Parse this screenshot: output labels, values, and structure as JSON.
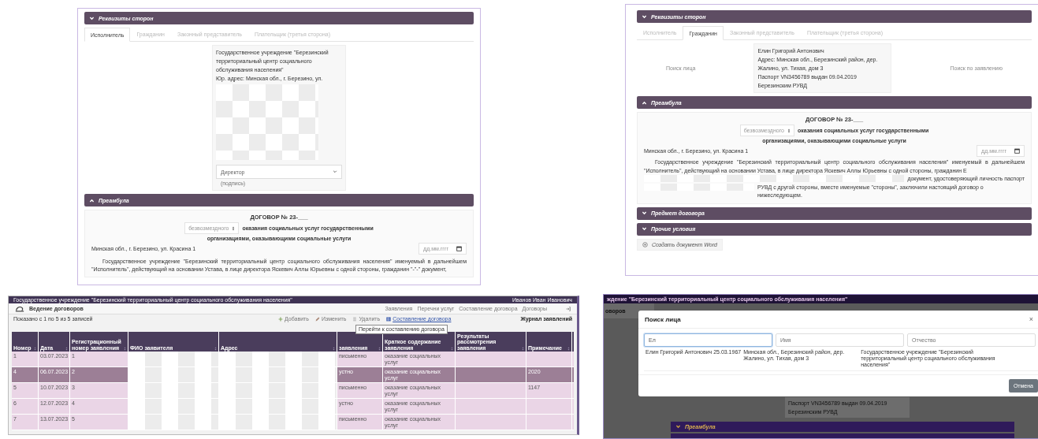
{
  "form_executor": {
    "sections": [
      {
        "title": "Реквизиты сторон",
        "kind": "down"
      },
      {
        "title": "Преамбула",
        "kind": "up"
      }
    ],
    "tabs": [
      {
        "label": "Исполнитель",
        "selected": true
      },
      {
        "label": "Гражданин",
        "selected": false
      },
      {
        "label": "Законный представитель",
        "selected": false
      },
      {
        "label": "Плательщик (третья сторона)",
        "selected": false
      }
    ],
    "org_card": {
      "name": "Государственное учреждение \"Березинский территориальный центр социального обслуживания населения\"",
      "address": "Юр. адрес: Минская обл., г. Березино, ул.",
      "signer_select": "Директор",
      "signer_caption": "(подпись)"
    },
    "preamble": {
      "heading": "ДОГОВОР № 23-___",
      "contract_type": "безвозмездного",
      "title_line_1": "оказания социальных услуг государственными",
      "title_line_2": "организациями, оказывающими социальные услуги",
      "place": "Минская обл., г. Березино, ул. Красина 1",
      "date_placeholder": "дд.мм.гггг",
      "paragraph": "Государственное учреждение \"Березинский территориальный центр социального обслуживания населения\" именуемый в дальнейшем \"Исполнитель\", действующий на основании Устава, в лице директора Яскевич Аллы Юрьевны с одной стороны, гражданин \"-\"-\" документ,"
    }
  },
  "form_citizen": {
    "sections": [
      {
        "title": "Реквизиты сторон",
        "kind": "down"
      },
      {
        "title": "Преамбула",
        "kind": "up"
      },
      {
        "title": "Предмет договора",
        "kind": "down"
      },
      {
        "title": "Прочие условия",
        "kind": "down"
      }
    ],
    "tabs": [
      {
        "label": "Исполнитель",
        "selected": false
      },
      {
        "label": "Гражданин",
        "selected": true
      },
      {
        "label": "Законный представитель",
        "selected": false
      },
      {
        "label": "Плательщик (третья сторона)",
        "selected": false
      }
    ],
    "search_person_link": "Поиск лица",
    "search_by_application_link": "Поиск по заявлению",
    "citizen_card": {
      "name": "Елин Григорий Антонович",
      "address": "Адрес: Минская обл., Березинский район, дер. Жалино, ул. Тихая, дом 3",
      "passport": "Паспорт VN3456789 выдан 09.04.2019 Березинским РУВД"
    },
    "preamble": {
      "heading": "ДОГОВОР № 23-___",
      "contract_type": "безвозмездного",
      "title_line_1": "оказания социальных услуг государственными",
      "title_line_2": "организациями, оказывающими социальные услуги",
      "place": "Минская обл., г. Березино, ул. Красина 1",
      "date_placeholder": "дд.мм.гггг",
      "paragraph_parts": [
        "Государственное учреждение \"Березинский территориальный центр социального обслуживания населения\" именуемый в дальнейшем \"Исполнитель\", действующий на основании Устава, в лице директора Яскевич Аллы Юрьевны с одной стороны, гражданин Е",
        "документ, удостоверяющий личность паспорт",
        "РУВД с другой стороны, вместе именуемые \"стороны\", заключили настоящий договор о нижеследующем."
      ]
    },
    "word_button": "Создать документ Word"
  },
  "applications_journal": {
    "top_bar": {
      "organization": "Государственное учреждение \"Березинский территориальный центр социального обслуживания населения\"",
      "user": "Иванов Иван Иванович"
    },
    "app_title": "Ведение договоров",
    "nav": [
      "Заявления",
      "Перечни услуг",
      "Составление договора",
      "Договоры"
    ],
    "records_info": "Показано с 1 по 5 из 5 записей",
    "actions": [
      {
        "label": "Добавить",
        "kind": "add"
      },
      {
        "label": "Изменить",
        "kind": "edit"
      },
      {
        "label": "Удалить",
        "kind": "delete"
      },
      {
        "label": "Составление договора",
        "kind": "compose"
      }
    ],
    "tooltip": "Перейти к составлению договора",
    "journal_title": "Журнал заявлений",
    "columns": [
      "Номер",
      "Дата",
      "Регистрационный номер заявления",
      "ФИО заявителя",
      "Адрес",
      "заявления",
      "Краткое содержание заявления",
      "Результаты рассмотрения заявления",
      "Примечание"
    ],
    "rows": [
      {
        "number": "1",
        "date": "03.07.2023",
        "reg_number": "1",
        "form": "письменно",
        "summary": "оказание социальных услуг",
        "selected": false
      },
      {
        "number": "4",
        "date": "06.07.2023",
        "reg_number": "2",
        "form": "устно",
        "summary": "оказание социальных услуг",
        "note": "2020",
        "selected": true
      },
      {
        "number": "5",
        "date": "10.07.2023",
        "reg_number": "3",
        "form": "письменно",
        "summary": "оказание социальных услуг",
        "note": "1147",
        "selected": false
      },
      {
        "number": "6",
        "date": "12.07.2023",
        "reg_number": "4",
        "form": "устно",
        "summary": "оказание социальных услуг",
        "selected": false
      },
      {
        "number": "7",
        "date": "13.07.2023",
        "reg_number": "5",
        "form": "письменно",
        "summary": "оказание социальных услуг",
        "selected": false
      }
    ]
  },
  "person_search": {
    "background": {
      "top_bar": "ждение \"Березинский территориальный центр социального обслуживания населения\"",
      "app_title": "оворов",
      "card_lines": [
        "Паспорт VN3456789 выдан 09.04.2019",
        "Березинским РУВД"
      ],
      "section": "Преамбула"
    },
    "modal": {
      "title": "Поиск лица",
      "close": "×",
      "fields": [
        {
          "value": "Ел",
          "focused": true
        },
        {
          "placeholder": "Имя",
          "focused": false
        },
        {
          "placeholder": "Отчество",
          "focused": false
        }
      ],
      "result": {
        "person": "Елин Григорий Антонович 25.03.1967",
        "address": "Минская обл., Березинский район, дер. Жалино, ул. Тихая, дом 3",
        "organization": "Государственное учреждение \"Березинский территориальный центр социального обслуживания населения\""
      },
      "cancel_button": "Отмена"
    }
  }
}
